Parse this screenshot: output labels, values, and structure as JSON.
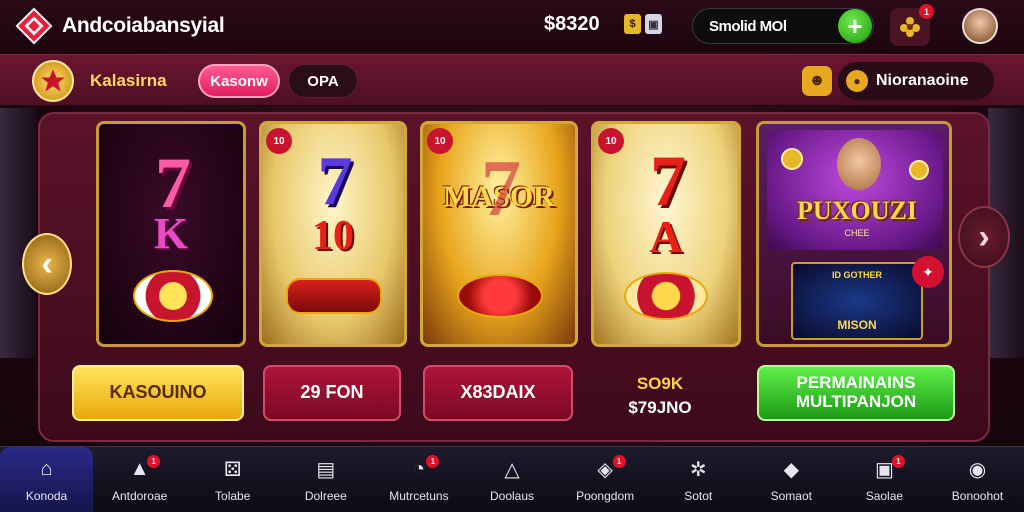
{
  "header": {
    "app_title": "Andcoiabansyial",
    "balance": "$8320",
    "search_placeholder": "Smolid MOl",
    "add_label": "+",
    "gift_badge": "1"
  },
  "subbar": {
    "brand_name": "Kalasirna",
    "tabs": [
      {
        "label": "Kasonw",
        "active": true
      },
      {
        "label": "OPA"
      }
    ],
    "profile_name": "Nioranaoine"
  },
  "cards": [
    {
      "line1": "7",
      "line2": "K"
    },
    {
      "corner": "10",
      "line1": "7",
      "line2": "10"
    },
    {
      "corner": "10",
      "line1": "MASOR",
      "line2": "7"
    },
    {
      "corner": "10",
      "line1": "7",
      "line2": "A"
    },
    {
      "title": "PUXOUZI",
      "subtitle": "CHEE",
      "thumb_title": "ID GOTHER",
      "thumb_name": "MISON"
    }
  ],
  "actions": {
    "gold": "KASOUINO",
    "red1": "29 FON",
    "red2": "X83DAIX",
    "price_top": "SO9K",
    "price_bottom": "$79JNO",
    "green_line1": "PERMAINAINS",
    "green_line2": "MULTIPANJON"
  },
  "bottom_nav": [
    {
      "label": "Konoda",
      "icon": "home-icon",
      "active": true
    },
    {
      "label": "Antdoroae",
      "icon": "house-icon",
      "badge": "1"
    },
    {
      "label": "Tolabe",
      "icon": "dice-icon"
    },
    {
      "label": "Dolreee",
      "icon": "box-icon"
    },
    {
      "label": "Mutrcetuns",
      "icon": "gauge-icon",
      "badge": "1"
    },
    {
      "label": "Doolaus",
      "icon": "tent-icon"
    },
    {
      "label": "Poongdom",
      "icon": "shield-icon",
      "badge": "1"
    },
    {
      "label": "Sotot",
      "icon": "gear-icon"
    },
    {
      "label": "Somaot",
      "icon": "bell-icon"
    },
    {
      "label": "Saolae",
      "icon": "gift-icon",
      "badge": "1"
    },
    {
      "label": "Bonoohot",
      "icon": "target-icon"
    }
  ],
  "colors": {
    "accent_pink": "#e01f62",
    "gold": "#e8a80c",
    "green": "#1c9a14",
    "maroon": "#5b1329"
  }
}
